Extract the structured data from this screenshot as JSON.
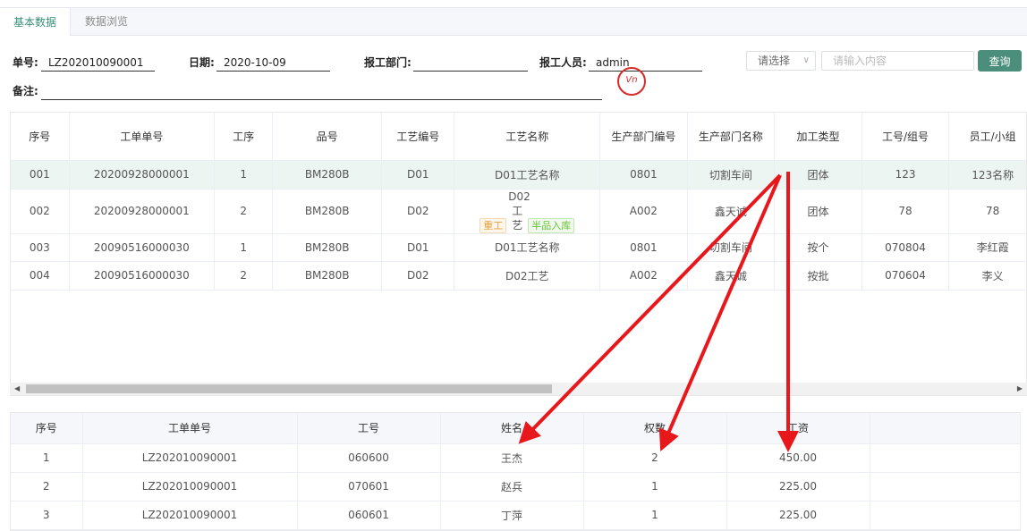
{
  "tabs": [
    "基本数据",
    "数据浏览"
  ],
  "form": {
    "order_label": "单号:",
    "order_value": "LZ202010090001",
    "date_label": "日期:",
    "date_value": "2020-10-09",
    "dept_label": "报工部门:",
    "dept_value": "",
    "staff_label": "报工人员:",
    "staff_value": "admin",
    "remark_label": "备注:",
    "remark_value": ""
  },
  "search": {
    "select_placeholder": "请选择",
    "input_placeholder": "请输入内容",
    "button": "查询"
  },
  "stamp_text": "Vn",
  "main_table": {
    "headers": [
      "序号",
      "工单单号",
      "工序",
      "品号",
      "工艺编号",
      "工艺名称",
      "生产部门编号",
      "生产部门名称",
      "加工类型",
      "工号/组号",
      "员工/小组"
    ],
    "rows": [
      {
        "seq": "001",
        "order": "20200928000001",
        "step": "1",
        "item": "BM280B",
        "craft_no": "D01",
        "craft_name": "D01工艺名称",
        "dept_no": "0801",
        "dept_name": "切割车间",
        "type": "团体",
        "emp_no": "123",
        "emp_name": "123名称"
      },
      {
        "seq": "002",
        "order": "20200928000001",
        "step": "2",
        "item": "BM280B",
        "craft_no": "D02",
        "craft_name": "D02工艺",
        "tag1": "重工",
        "tag2": "半品入库",
        "dept_no": "A002",
        "dept_name": "鑫天诚",
        "type": "团体",
        "emp_no": "78",
        "emp_name": "78"
      },
      {
        "seq": "003",
        "order": "20090516000030",
        "step": "1",
        "item": "BM280B",
        "craft_no": "D01",
        "craft_name": "D01工艺名称",
        "dept_no": "0801",
        "dept_name": "切割车间",
        "type": "按个",
        "emp_no": "070804",
        "emp_name": "李红霞"
      },
      {
        "seq": "004",
        "order": "20090516000030",
        "step": "2",
        "item": "BM280B",
        "craft_no": "D02",
        "craft_name": "D02工艺",
        "dept_no": "A002",
        "dept_name": "鑫天诚",
        "type": "按批",
        "emp_no": "070604",
        "emp_name": "李义"
      }
    ]
  },
  "detail_table": {
    "headers": [
      "序号",
      "工单单号",
      "工号",
      "姓名",
      "权数",
      "工资"
    ],
    "rows": [
      {
        "seq": "1",
        "order": "LZ202010090001",
        "emp_no": "060600",
        "name": "王杰",
        "weight": "2",
        "wage": "450.00"
      },
      {
        "seq": "2",
        "order": "LZ202010090001",
        "emp_no": "070601",
        "name": "赵兵",
        "weight": "1",
        "wage": "225.00"
      },
      {
        "seq": "3",
        "order": "LZ202010090001",
        "emp_no": "060601",
        "name": "丁萍",
        "weight": "1",
        "wage": "225.00"
      }
    ]
  },
  "colors": {
    "accent": "#3a8e7a",
    "button": "#4c8e7c",
    "arrow": "#e8171b",
    "selected_row": "#ecf5f1"
  }
}
